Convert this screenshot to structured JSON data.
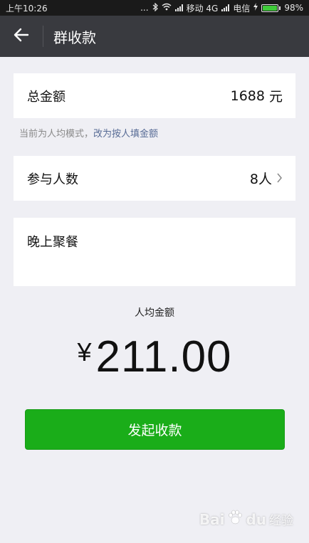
{
  "status_bar": {
    "time": "上午10:26",
    "dots": "...",
    "carrier1": "移动 4G",
    "carrier2": "电信",
    "battery": "98%"
  },
  "nav": {
    "title": "群收款",
    "back_icon": "arrow-left-icon"
  },
  "total": {
    "label": "总金额",
    "value": "1688",
    "unit": "元"
  },
  "hint": {
    "text": "当前为人均模式，",
    "link": "改为按人填金额"
  },
  "participants": {
    "label": "参与人数",
    "value": "8人",
    "chevron_icon": "chevron-right-icon"
  },
  "note": {
    "value": "晚上聚餐"
  },
  "average": {
    "label": "人均金额",
    "currency": "¥",
    "amount": "211.00"
  },
  "action": {
    "label": "发起收款"
  },
  "watermark": {
    "brand": "Bai",
    "paw": "du",
    "sub": "经验"
  },
  "colors": {
    "accent_green": "#1aad19",
    "nav_bg": "#393a3f",
    "link_blue": "#576b95",
    "page_bg": "#efeff4"
  }
}
